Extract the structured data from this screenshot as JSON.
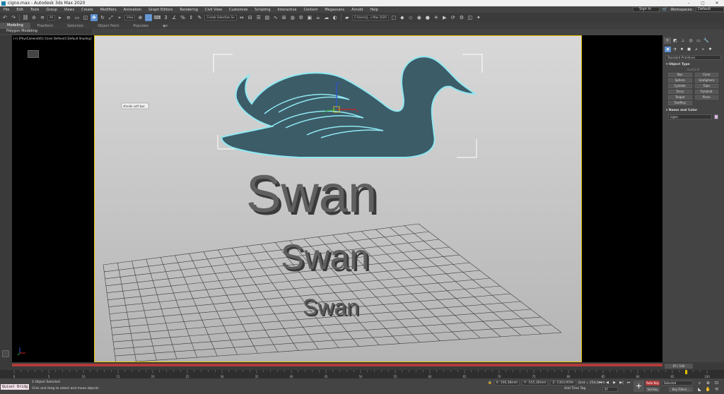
{
  "window": {
    "title": "cigno.max - Autodesk 3ds Max 2020",
    "controls": [
      "–",
      "▢",
      "✕"
    ]
  },
  "menu": {
    "items": [
      "File",
      "Edit",
      "Tools",
      "Group",
      "Views",
      "Create",
      "Modifiers",
      "Animation",
      "Graph Editors",
      "Rendering",
      "Civil View",
      "Customize",
      "Scripting",
      "Interactive",
      "Content",
      "Megascans",
      "Arnold",
      "Help"
    ],
    "sign_in": "Sign In",
    "workspaces_label": "Workspaces:",
    "workspaces_value": "Default"
  },
  "toolbar": {
    "selection_filter": "All",
    "ref_coord": "View",
    "named_selection": "Create Selection Se",
    "project_path": "C:\\Users\\J...s Max 2020"
  },
  "ribbon": {
    "tabs": [
      "Modeling",
      "Freeform",
      "Selection",
      "Object Paint",
      "Populate"
    ],
    "sub_label": "Polygon Modeling"
  },
  "viewport": {
    "label": "[+] [PhysCamera001] [User Defined] [Default Shading]",
    "tooltip": "sfondo soft box",
    "text_large": "Swan",
    "text_medium": "Swan",
    "text_small": "Swan",
    "axis": {
      "x": "x",
      "y": "y",
      "z": "z"
    }
  },
  "command_panel": {
    "category": "Standard Primitives",
    "object_type_title": "Object Type",
    "autogrid": "AutoGrid",
    "object_types": [
      "Box",
      "Cone",
      "Sphere",
      "GeoSphere",
      "Cylinder",
      "Tube",
      "Torus",
      "Pyramid",
      "Teapot",
      "Plane",
      "TextPlus"
    ],
    "name_color_title": "Name and Color",
    "name_value": "cigno",
    "swatch_color": "#d9b8e6"
  },
  "timeline": {
    "frame_label": "97 / 100",
    "ticks": [
      "0",
      "5",
      "10",
      "15",
      "20",
      "25",
      "30",
      "35",
      "40",
      "45",
      "50",
      "55",
      "60",
      "65",
      "70",
      "75",
      "80",
      "85",
      "90",
      "95",
      "100"
    ]
  },
  "status": {
    "maxscript": "Quixel Bridg",
    "selection": "1 Object Selected",
    "prompt": "Click and drag to select and move objects",
    "x": "X: 106,38mm",
    "y": "Y: -555,36mm",
    "z": "Z: 1303,959n",
    "grid": "Grid = 254,0mm",
    "add_time_tag": "Add Time Tag",
    "auto_key": "Auto Key",
    "set_key": "Set Key",
    "selected": "Selected",
    "key_filters": "Key Filters...",
    "current_frame": "97"
  },
  "colors": {
    "swan": "#3c5c68",
    "swan_outline": "#8fe8f2",
    "viewport_bg_top": "#d8d8d8",
    "viewport_bg_bottom": "#b4b4b4",
    "text3d": "#555555",
    "accent": "#5b8fcf",
    "autokey": "#b23a3a"
  }
}
